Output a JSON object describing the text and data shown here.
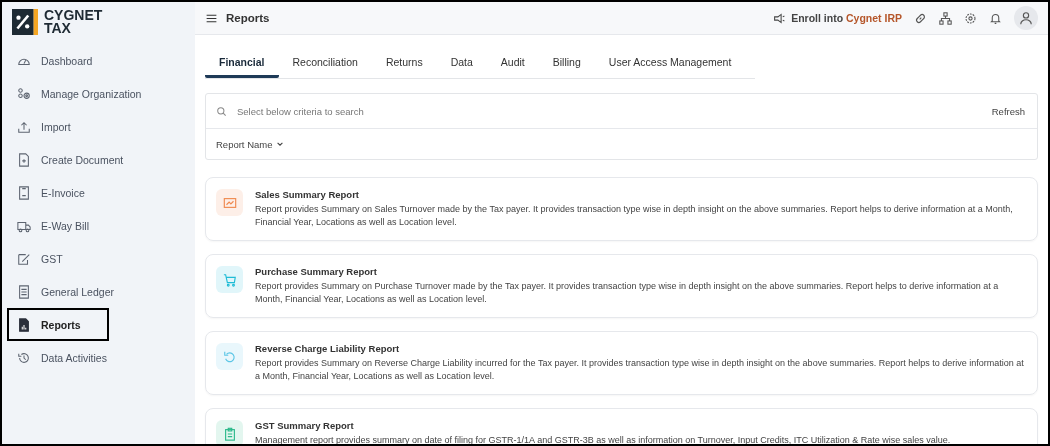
{
  "logo": {
    "line1": "CYGNET",
    "line2": "TAX"
  },
  "sidebar": {
    "items": [
      {
        "label": "Dashboard",
        "selected": false
      },
      {
        "label": "Manage Organization",
        "selected": false
      },
      {
        "label": "Import",
        "selected": false
      },
      {
        "label": "Create Document",
        "selected": false
      },
      {
        "label": "E-Invoice",
        "selected": false
      },
      {
        "label": "E-Way Bill",
        "selected": false
      },
      {
        "label": "GST",
        "selected": false
      },
      {
        "label": "General Ledger",
        "selected": false
      },
      {
        "label": "Reports",
        "selected": true
      },
      {
        "label": "Data Activities",
        "selected": false
      }
    ]
  },
  "header": {
    "title": "Reports",
    "enroll_prefix": "Enroll into ",
    "enroll_brand": "Cygnet IRP"
  },
  "tabs": [
    {
      "label": "Financial",
      "selected": true
    },
    {
      "label": "Reconciliation",
      "selected": false
    },
    {
      "label": "Returns",
      "selected": false
    },
    {
      "label": "Data",
      "selected": false
    },
    {
      "label": "Audit",
      "selected": false
    },
    {
      "label": "Billing",
      "selected": false
    },
    {
      "label": "User Access Management",
      "selected": false
    }
  ],
  "search": {
    "placeholder": "Select below criteria to search",
    "refresh": "Refresh",
    "filter": "Report Name"
  },
  "reports": [
    {
      "title": "Sales Summary Report",
      "description": "Report provides Summary on Sales Turnover made by the Tax payer. It provides transaction type wise in depth insight on the above summaries. Report helps to derive information at a Month, Financial Year, Locations as well as Location level.",
      "color": "#f0894f"
    },
    {
      "title": "Purchase Summary Report",
      "description": "Report provides Summary on Purchase Turnover made by the Tax payer. It provides transaction type wise in depth insight on the above summaries. Report helps to derive information at a Month, Financial Year, Locations as well as Location level.",
      "color": "#1fbcd6"
    },
    {
      "title": "Reverse Charge Liability Report",
      "description": "Report provides Summary on Reverse Charge Liability incurred for the Tax payer. It provides transaction type wise in depth insight on the above summaries. Report helps to derive information at a Month, Financial Year, Locations as well as Location level.",
      "color": "#5cc6e6"
    },
    {
      "title": "GST Summary Report",
      "description": "Management report provides summary on date of filing for GSTR-1/1A and GSTR-3B as well as information on Turnover, Input Credits, ITC Utilization & Rate wise sales value.",
      "color": "#2bb98a"
    }
  ]
}
